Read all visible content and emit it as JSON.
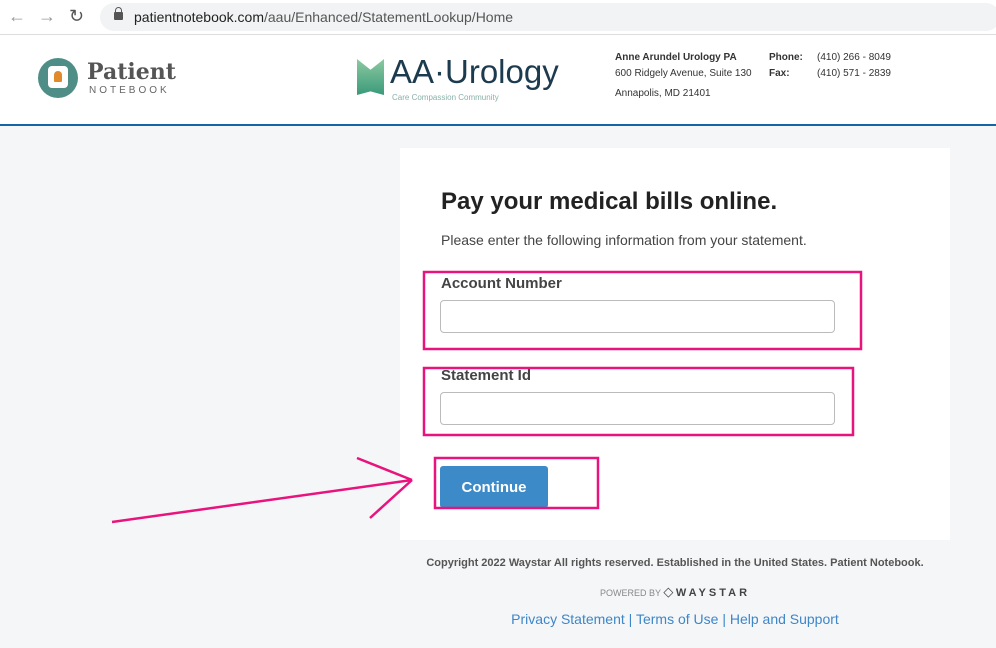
{
  "browser": {
    "url_host": "patientnotebook.com",
    "url_path": "/aau/Enhanced/StatementLookup/Home"
  },
  "header": {
    "logo_patient": {
      "title": "Patient",
      "subtitle": "NOTEBOOK"
    },
    "logo_practice": {
      "title": "AA·Urology",
      "tagline": "Care Compassion Community"
    },
    "practice_name": "Anne Arundel Urology PA",
    "address_line1": "600 Ridgely Avenue, Suite 130",
    "address_line2": "Annapolis, MD 21401",
    "phone_label": "Phone:",
    "phone": "(410) 266 - 8049",
    "fax_label": "Fax:",
    "fax": "(410) 571 - 2839"
  },
  "form": {
    "title": "Pay your medical bills online.",
    "subtitle": "Please enter the following information from your statement.",
    "account_label": "Account Number",
    "account_value": "",
    "statement_label": "Statement Id",
    "statement_value": "",
    "continue_label": "Continue"
  },
  "footer": {
    "copyright": "Copyright 2022 Waystar All rights reserved. Established in the United States. Patient Notebook.",
    "powered_by": "POWERED BY",
    "brand": "WAYSTAR",
    "links": [
      "Privacy Statement",
      "Terms of Use",
      "Help and Support"
    ],
    "separator": "|"
  },
  "annotation_color": "#e8137c",
  "accent": "#3d8ac9"
}
